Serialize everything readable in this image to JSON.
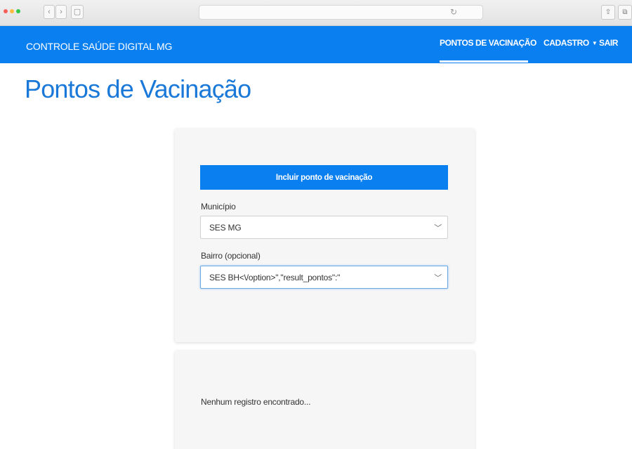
{
  "navbar": {
    "brand": "CONTROLE SAÚDE DIGITAL MG",
    "items": [
      {
        "label": "PONTOS DE VACINAÇÃO",
        "active": true
      },
      {
        "label": "CADASTRO",
        "dropdown": true
      },
      {
        "label": "SAIR"
      }
    ]
  },
  "page": {
    "title": "Pontos de Vacinação"
  },
  "form": {
    "include_button": "Incluir ponto de vacinação",
    "municipio": {
      "label": "Município",
      "value": "SES MG"
    },
    "bairro": {
      "label": "Bairro (opcional)",
      "value": "SES BH<\\/option>\",\"result_pontos\":\""
    }
  },
  "results": {
    "empty_message": "Nenhum registro encontrado..."
  },
  "colors": {
    "primary": "#0a7ff0",
    "title": "#1a79d8",
    "card_bg": "#f6f6f6"
  }
}
